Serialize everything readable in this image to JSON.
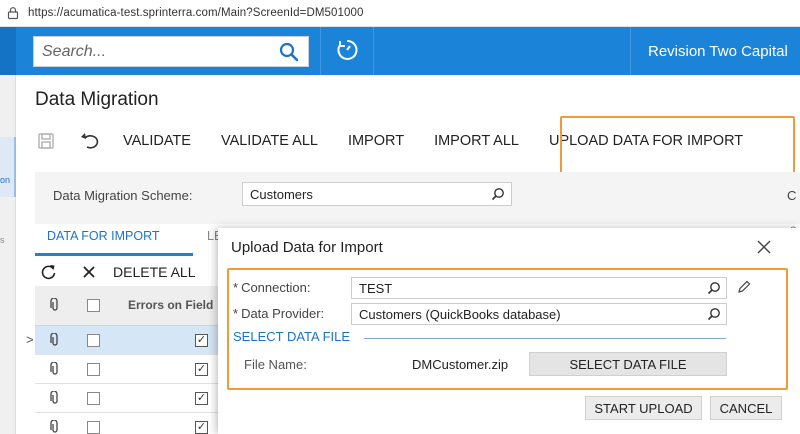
{
  "browser": {
    "url": "https://acumatica-test.sprinterra.com/Main?ScreenId=DM501000"
  },
  "header": {
    "search_placeholder": "Search...",
    "company": "Revision Two Capital"
  },
  "leftnav": {
    "frag1": "on",
    "frag2": "s"
  },
  "page": {
    "title": "Data Migration"
  },
  "toolbar": {
    "validate": "VALIDATE",
    "validate_all": "VALIDATE ALL",
    "import": "IMPORT",
    "import_all": "IMPORT ALL",
    "upload": "UPLOAD DATA FOR IMPORT"
  },
  "form": {
    "scheme_label": "Data Migration Scheme:",
    "scheme_value": "Customers"
  },
  "tabs": {
    "data_for_import": "DATA FOR IMPORT",
    "second": "LE"
  },
  "grid": {
    "delete_all": "DELETE ALL",
    "header_errors": "Errors on Field",
    "rows": [
      {
        "selected": true,
        "checked": true
      },
      {
        "selected": false,
        "checked": true
      },
      {
        "selected": false,
        "checked": true
      },
      {
        "selected": false,
        "checked": true
      }
    ],
    "edge_c": "C",
    "edge_e": "e"
  },
  "dialog": {
    "title": "Upload Data for Import",
    "connection_label": "Connection:",
    "connection_value": "TEST",
    "provider_label": "Data Provider:",
    "provider_value": "Customers (QuickBooks database)",
    "section": "SELECT DATA FILE",
    "file_name_label": "File Name:",
    "file_name_value": "DMCustomer.zip",
    "select_file_button": "SELECT DATA FILE",
    "start_upload": "START UPLOAD",
    "cancel": "CANCEL",
    "required_mark": "*"
  },
  "colors": {
    "brand_blue": "#1c84d8",
    "highlight_orange": "#f29a3a",
    "link_blue": "#1c74c8"
  }
}
